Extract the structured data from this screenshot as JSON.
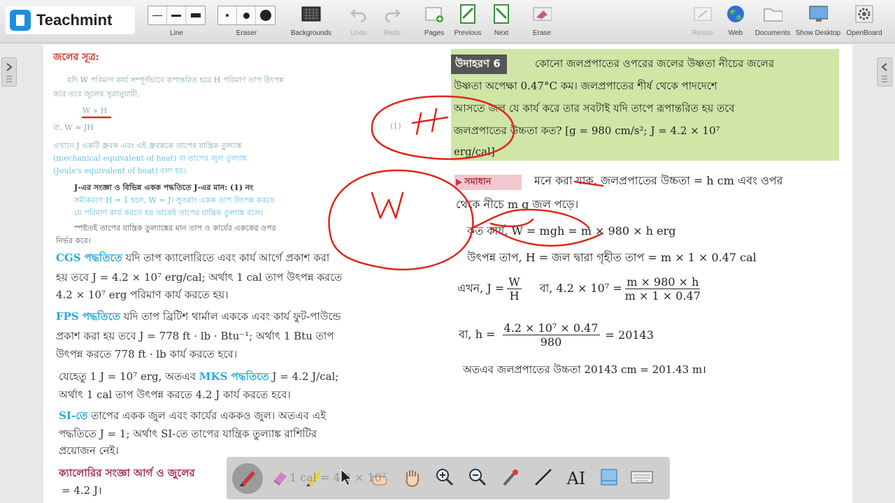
{
  "toolbar": {
    "brand": "Teachmint",
    "line_label": "Line",
    "eraser_label": "Eraser",
    "backgrounds_label": "Backgrounds",
    "undo_label": "Undo",
    "redo_label": "Redo",
    "pages_label": "Pages",
    "previous_label": "Previous",
    "next_label": "Next",
    "erase_label": "Erase",
    "resize_label": "Resize",
    "web_label": "Web",
    "documents_label": "Documents",
    "show_desktop_label": "Show Desktop",
    "openboard_label": "OpenBoard"
  },
  "book_left": {
    "l1": "জলের সূত্র:",
    "l2": "যদি W পরিমাণ কার্য সম্পূর্ণভাবে রূপান্তরিত হয়ে H পরিমাণ তাপ উৎপন্ন",
    "l3": "করে তবে জুলের সূত্রানুযায়ী,",
    "l4": "W ∝ H",
    "l5": "বা,     W = JH",
    "l5b": "(1)",
    "l6": "এখানে J একটি ধ্রুবক এবং এই ধ্রুবককে তাপের যান্ত্রিক তুল্যাঙ্ক",
    "l7": "(mechanical equivalent of heat) বা তাপের জুল তুল্যাঙ্ক",
    "l8": "(Joule's equivalent of heat) বলা হয়।",
    "l9": "J-এর সংজ্ঞা ও বিভিন্ন একক পদ্ধতিতে J-এর মান: (1) নং",
    "l10": "সমীকরণে H = 1 হলে, W = J। সুতরাং একক তাপ উৎপন্ন করতে",
    "l11": "যে পরিমাণ কার্য করতে হয় তাকেই তাপের যান্ত্রিক তুল্যাঙ্ক বলে।",
    "l12": "স্পষ্টতই তাপের যান্ত্রিক তুল্যাঙ্কের মান তাপ ও কার্যের এককের ওপর",
    "l13": "নির্ভর করে।",
    "l14a": "CGS পদ্ধতিতে",
    "l14b": " যদি তাপ ক্যালোরিতে এবং কার্য আর্গে প্রকাশ করা",
    "l15": "হয় তবে J = 4.2 × 10⁷ erg/cal; অর্থাৎ 1 cal তাপ উৎপন্ন করতে",
    "l16": "4.2 × 10⁷ erg পরিমাণ কার্য করতে হয়।",
    "l17a": "FPS পদ্ধতিতে",
    "l17b": " যদি তাপ ব্রিটিশ থার্মাল এককে এবং কার্য ফুট-পাউন্ডে",
    "l18": "প্রকাশ করা হয় তবে J = 778 ft · lb · Btu⁻¹; অর্থাৎ 1 Btu তাপ",
    "l19": "উৎপন্ন করতে 778 ft · lb কার্য করতে হবে।",
    "l20a": "যেহেতু 1 J = 10⁷ erg, অতএব ",
    "l20b": "MKS পদ্ধতিতে",
    "l20c": " J = 4.2 J/cal;",
    "l21": "অর্থাৎ 1 cal তাপ উৎপন্ন করতে 4.2 J কার্য করতে হবে।",
    "l22a": "SI-তে",
    "l22b": " তাপের একক জুল এবং কার্যের এককও জুল। অতএব এই",
    "l23": "পদ্ধতিতে J = 1; অর্থাৎ SI-তে তাপের যান্ত্রিক তুল্যাঙ্ক রাশিটির",
    "l24": "প্রয়োজন নেই।",
    "l25": "ক্যালোরির সংজ্ঞা আর্গ ও জুলের",
    "l26": "= 4.2 J।"
  },
  "example": {
    "tag": "উদাহরণ 6",
    "line1": "কোনো জলপ্রপাতের ওপরের জলের উষ্ণতা নীচের জলের",
    "line2": "উষ্ণতা অপেক্ষা 0.47°C কম। জলপ্রপাতের শীর্ষ থেকে পাদদেশে",
    "line3": "আসতে জল যে কার্য করে তার সবটাই যদি তাপে রূপান্তরিত হয় তবে",
    "line4": "জলপ্রপাতের উচ্চতা কত? [g = 980 cm/s²; J = 4.2 × 10⁷",
    "line5": "erg/cal]"
  },
  "solution": {
    "tag": "সমাধান",
    "line1": "মনে করা যাক, জলপ্রপাতের উচ্চতা = h cm এবং ওপর",
    "line2": "থেকে নীচে m g জল পড়ে।",
    "line3": "কৃত কার্য, W = mgh = m × 980 × h erg",
    "line4": "উৎপন্ন তাপ, H = জল দ্বারা গৃহীত তাপ = m × 1 × 0.47 cal",
    "eq_prefix": "এখন, J =",
    "eq_num1": "W",
    "eq_den1": "H",
    "eq_mid": "বা,   4.2 × 10⁷ =",
    "eq_num2": "m × 980 × h",
    "eq_den2": "m × 1 × 0.47",
    "h_prefix": "বা,     h =",
    "h_num": "4.2 × 10⁷ × 0.47",
    "h_den": "980",
    "h_result": "= 20143",
    "final": "অতএব জলপ্রপাতের উচ্চতা 20143 cm = 201.43 m।"
  },
  "bottom_toolbar": {
    "ghost_text": "1 cal = 4.2 × 10⁷"
  },
  "colors": {
    "annotation": "#e0261b",
    "example_bg": "#cfe6a7",
    "accent_blue": "#2aa9d8"
  }
}
